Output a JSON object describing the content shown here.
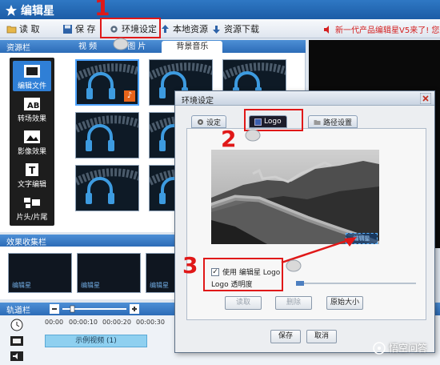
{
  "app": {
    "title": "编辑星"
  },
  "toolbar": {
    "read_label": "读 取",
    "save_label": "保 存",
    "env_label": "环境设定",
    "local_label": "本地资源",
    "download_label": "资源下载",
    "promo_text": "新一代产品编辑星V5来了! 您既"
  },
  "resource": {
    "header": "资源栏",
    "tabs": [
      {
        "label": "视 频"
      },
      {
        "label": "图 片"
      },
      {
        "label": "背景音乐"
      }
    ],
    "side_items": [
      {
        "label": "编辑文件",
        "icon": "film-icon"
      },
      {
        "label": "转场效果",
        "icon": "ab-icon"
      },
      {
        "label": "影像效果",
        "icon": "effect-icon"
      },
      {
        "label": "文字编辑",
        "icon": "text-icon"
      },
      {
        "label": "片头/片尾",
        "icon": "title-icon"
      }
    ]
  },
  "effects": {
    "header": "效果收集栏",
    "items": [
      {
        "label": "编辑星"
      },
      {
        "label": "编辑星"
      },
      {
        "label": "编辑星"
      }
    ]
  },
  "timeline": {
    "header": "轨道栏",
    "ruler": [
      "00:00",
      "00:00:10",
      "00:00:20",
      "00:00:30"
    ],
    "clip_label": "示例视频 (1)"
  },
  "dialog": {
    "title": "环境设定",
    "tabs": [
      {
        "label": "设定"
      },
      {
        "label": "Logo"
      },
      {
        "label": "路径设置"
      }
    ],
    "logo_overlay": "编辑星",
    "use_logo_label": "使用 编辑星 Logo",
    "opacity_label": "Logo 透明度",
    "read_button": "读取",
    "delete_button": "删除",
    "original_size_button": "原始大小",
    "save_button": "保存",
    "cancel_button": "取消"
  },
  "annotations": {
    "marker_1": "1",
    "marker_2": "2",
    "marker_3": "3"
  },
  "watermark": {
    "text": "悟空问答"
  }
}
